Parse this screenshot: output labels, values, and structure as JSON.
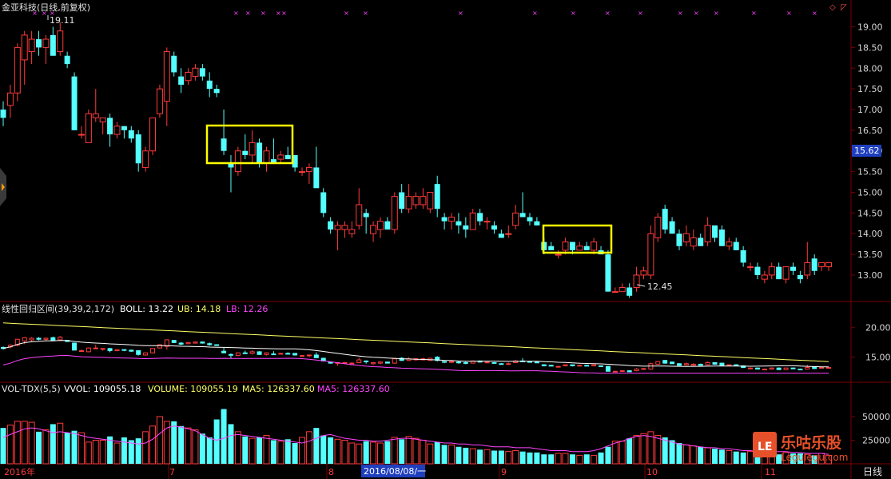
{
  "header": {
    "stock_name": "金亚科技(日线,前复权)",
    "high_label": "19.11",
    "low_label": "12.45",
    "current_price": "15.62"
  },
  "colors": {
    "bg": "#000000",
    "up": "#ff3b3b",
    "down": "#54ffff",
    "grid": "#7a0000",
    "axis_text": "#d6d6d6",
    "highlight_box": "#ffff00",
    "price_tag_bg": "#1f3fbf",
    "boll_mid": "#ffffff",
    "boll_ub": "#ffff66",
    "boll_lb": "#ff44ff",
    "vol_ma": "#ff44ff"
  },
  "boll_panel": {
    "title": "线性回归区间(39,39,2,172)",
    "boll": "BOLL: 13.22",
    "ub": "UB: 14.18",
    "lb": "LB: 12.26"
  },
  "vol_panel": {
    "title": "VOL-TDX(5,5)",
    "vvol": "VVOL: 109055.18",
    "volume": "VOLUME: 109055.19",
    "ma5": "MA5: 126337.60",
    "ma5b": "MA5: 126337.60"
  },
  "x_axis": {
    "labels": [
      "2016年",
      "7",
      "8",
      "9",
      "10",
      "11"
    ],
    "selected_date": "2016/08/08/一",
    "period_button": "日线"
  },
  "watermark": {
    "logo_letter": "LE",
    "brand": "乐咕乐股",
    "url": "Legulegu.com"
  },
  "chart_data": {
    "type": "candlestick",
    "price_axis": {
      "ticks": [
        13.0,
        13.5,
        14.0,
        14.5,
        15.0,
        15.5,
        16.0,
        16.5,
        17.0,
        17.5,
        18.0,
        18.5,
        19.0
      ],
      "range": [
        12.4,
        19.3
      ]
    },
    "boll_axis": {
      "ticks": [
        15.0,
        20.0
      ],
      "tick_labels": [
        "15.00",
        "20.00"
      ]
    },
    "volume_axis": {
      "ticks": [
        25000,
        50000
      ],
      "tick_labels": [
        "25000",
        "50000"
      ],
      "range": [
        0,
        72000
      ]
    },
    "candles": [
      {
        "o": 17.0,
        "h": 17.2,
        "l": 16.6,
        "c": 16.8
      },
      {
        "o": 17.1,
        "h": 17.6,
        "l": 16.8,
        "c": 17.4
      },
      {
        "o": 17.4,
        "h": 18.6,
        "l": 17.2,
        "c": 18.5
      },
      {
        "o": 18.2,
        "h": 18.9,
        "l": 17.6,
        "c": 18.8
      },
      {
        "o": 18.4,
        "h": 18.9,
        "l": 18.1,
        "c": 18.7
      },
      {
        "o": 18.7,
        "h": 18.9,
        "l": 18.3,
        "c": 18.5
      },
      {
        "o": 18.5,
        "h": 18.8,
        "l": 18.1,
        "c": 18.7
      },
      {
        "o": 18.8,
        "h": 19.0,
        "l": 18.3,
        "c": 18.3
      },
      {
        "o": 18.4,
        "h": 19.11,
        "l": 18.3,
        "c": 18.9
      },
      {
        "o": 18.3,
        "h": 18.4,
        "l": 18.0,
        "c": 18.1
      },
      {
        "o": 17.8,
        "h": 17.9,
        "l": 16.5,
        "c": 16.5
      },
      {
        "o": 16.4,
        "h": 16.6,
        "l": 16.3,
        "c": 16.4
      },
      {
        "o": 16.2,
        "h": 17.0,
        "l": 16.2,
        "c": 16.9
      },
      {
        "o": 16.8,
        "h": 17.5,
        "l": 16.7,
        "c": 16.9
      },
      {
        "o": 16.7,
        "h": 16.8,
        "l": 16.4,
        "c": 16.8
      },
      {
        "o": 16.8,
        "h": 16.9,
        "l": 16.1,
        "c": 16.4
      },
      {
        "o": 16.4,
        "h": 16.7,
        "l": 16.3,
        "c": 16.6
      },
      {
        "o": 16.6,
        "h": 16.6,
        "l": 16.3,
        "c": 16.5
      },
      {
        "o": 16.5,
        "h": 16.6,
        "l": 16.2,
        "c": 16.3
      },
      {
        "o": 16.4,
        "h": 16.5,
        "l": 15.5,
        "c": 15.7
      },
      {
        "o": 15.6,
        "h": 16.1,
        "l": 15.5,
        "c": 16.0
      },
      {
        "o": 16.0,
        "h": 16.8,
        "l": 15.9,
        "c": 16.8
      },
      {
        "o": 16.9,
        "h": 17.6,
        "l": 16.8,
        "c": 17.5
      },
      {
        "o": 17.2,
        "h": 18.5,
        "l": 16.6,
        "c": 18.4
      },
      {
        "o": 18.3,
        "h": 18.4,
        "l": 17.8,
        "c": 17.9
      },
      {
        "o": 17.8,
        "h": 18.0,
        "l": 17.4,
        "c": 17.6
      },
      {
        "o": 17.7,
        "h": 18.0,
        "l": 17.6,
        "c": 17.9
      },
      {
        "o": 17.8,
        "h": 18.1,
        "l": 17.7,
        "c": 18.0
      },
      {
        "o": 18.0,
        "h": 18.1,
        "l": 17.7,
        "c": 17.8
      },
      {
        "o": 17.7,
        "h": 17.9,
        "l": 17.3,
        "c": 17.5
      },
      {
        "o": 17.5,
        "h": 17.6,
        "l": 17.3,
        "c": 17.4
      },
      {
        "o": 16.3,
        "h": 17.0,
        "l": 15.9,
        "c": 16.0
      },
      {
        "o": 15.7,
        "h": 15.9,
        "l": 15.0,
        "c": 15.6
      },
      {
        "o": 15.5,
        "h": 16.1,
        "l": 15.4,
        "c": 16.0
      },
      {
        "o": 16.0,
        "h": 16.4,
        "l": 15.8,
        "c": 15.9
      },
      {
        "o": 15.9,
        "h": 16.5,
        "l": 15.7,
        "c": 16.2
      },
      {
        "o": 16.2,
        "h": 16.3,
        "l": 15.6,
        "c": 15.7
      },
      {
        "o": 15.7,
        "h": 16.1,
        "l": 15.5,
        "c": 16.0
      },
      {
        "o": 15.8,
        "h": 16.3,
        "l": 15.7,
        "c": 15.7
      },
      {
        "o": 15.8,
        "h": 16.0,
        "l": 15.7,
        "c": 15.9
      },
      {
        "o": 15.9,
        "h": 16.1,
        "l": 15.8,
        "c": 15.8
      },
      {
        "o": 15.9,
        "h": 15.9,
        "l": 15.5,
        "c": 15.6
      },
      {
        "o": 15.5,
        "h": 15.6,
        "l": 15.4,
        "c": 15.5
      },
      {
        "o": 15.5,
        "h": 15.7,
        "l": 15.2,
        "c": 15.6
      },
      {
        "o": 15.6,
        "h": 16.1,
        "l": 15.3,
        "c": 15.1
      },
      {
        "o": 15.0,
        "h": 15.1,
        "l": 14.4,
        "c": 14.5
      },
      {
        "o": 14.3,
        "h": 14.4,
        "l": 14.0,
        "c": 14.1
      },
      {
        "o": 14.1,
        "h": 14.3,
        "l": 13.6,
        "c": 14.2
      },
      {
        "o": 14.1,
        "h": 14.3,
        "l": 13.9,
        "c": 14.2
      },
      {
        "o": 14.0,
        "h": 14.3,
        "l": 13.9,
        "c": 14.1
      },
      {
        "o": 14.2,
        "h": 15.1,
        "l": 14.1,
        "c": 14.7
      },
      {
        "o": 14.5,
        "h": 14.6,
        "l": 14.0,
        "c": 14.4
      },
      {
        "o": 14.0,
        "h": 14.3,
        "l": 13.8,
        "c": 14.2
      },
      {
        "o": 14.1,
        "h": 14.4,
        "l": 13.9,
        "c": 14.3
      },
      {
        "o": 14.3,
        "h": 14.4,
        "l": 14.1,
        "c": 14.1
      },
      {
        "o": 14.1,
        "h": 15.0,
        "l": 14.0,
        "c": 14.9
      },
      {
        "o": 15.0,
        "h": 15.2,
        "l": 14.5,
        "c": 14.6
      },
      {
        "o": 14.6,
        "h": 15.2,
        "l": 14.5,
        "c": 14.9
      },
      {
        "o": 14.7,
        "h": 15.0,
        "l": 14.6,
        "c": 14.9
      },
      {
        "o": 14.7,
        "h": 15.1,
        "l": 14.6,
        "c": 14.9
      },
      {
        "o": 14.6,
        "h": 15.0,
        "l": 14.5,
        "c": 15.0
      },
      {
        "o": 15.2,
        "h": 15.4,
        "l": 14.4,
        "c": 14.6
      },
      {
        "o": 14.4,
        "h": 14.5,
        "l": 14.1,
        "c": 14.3
      },
      {
        "o": 14.3,
        "h": 14.5,
        "l": 14.1,
        "c": 14.4
      },
      {
        "o": 14.3,
        "h": 14.5,
        "l": 14.0,
        "c": 14.2
      },
      {
        "o": 14.2,
        "h": 14.4,
        "l": 13.9,
        "c": 14.1
      },
      {
        "o": 14.1,
        "h": 14.6,
        "l": 14.1,
        "c": 14.5
      },
      {
        "o": 14.5,
        "h": 14.6,
        "l": 14.2,
        "c": 14.3
      },
      {
        "o": 14.3,
        "h": 14.4,
        "l": 14.1,
        "c": 14.3
      },
      {
        "o": 14.2,
        "h": 14.3,
        "l": 14.0,
        "c": 14.1
      },
      {
        "o": 14.0,
        "h": 14.1,
        "l": 13.9,
        "c": 13.9
      },
      {
        "o": 14.0,
        "h": 14.2,
        "l": 13.9,
        "c": 14.0
      },
      {
        "o": 14.2,
        "h": 14.7,
        "l": 14.1,
        "c": 14.5
      },
      {
        "o": 14.5,
        "h": 15.0,
        "l": 14.4,
        "c": 14.4
      },
      {
        "o": 14.4,
        "h": 14.5,
        "l": 14.2,
        "c": 14.3
      },
      {
        "o": 14.3,
        "h": 14.4,
        "l": 14.2,
        "c": 14.2
      },
      {
        "o": 13.8,
        "h": 13.9,
        "l": 13.5,
        "c": 13.6
      },
      {
        "o": 13.7,
        "h": 13.8,
        "l": 13.6,
        "c": 13.6
      },
      {
        "o": 13.5,
        "h": 13.6,
        "l": 13.4,
        "c": 13.5
      },
      {
        "o": 13.6,
        "h": 13.9,
        "l": 13.5,
        "c": 13.8
      },
      {
        "o": 13.8,
        "h": 13.8,
        "l": 13.5,
        "c": 13.6
      },
      {
        "o": 13.6,
        "h": 13.8,
        "l": 13.6,
        "c": 13.7
      },
      {
        "o": 13.7,
        "h": 13.8,
        "l": 13.6,
        "c": 13.6
      },
      {
        "o": 13.6,
        "h": 13.9,
        "l": 13.5,
        "c": 13.8
      },
      {
        "o": 13.6,
        "h": 13.7,
        "l": 13.5,
        "c": 13.5
      },
      {
        "o": 13.5,
        "h": 13.6,
        "l": 12.6,
        "c": 12.6
      },
      {
        "o": 12.6,
        "h": 12.7,
        "l": 12.6,
        "c": 12.6
      },
      {
        "o": 12.6,
        "h": 12.8,
        "l": 12.6,
        "c": 12.7
      },
      {
        "o": 12.7,
        "h": 12.8,
        "l": 12.45,
        "c": 12.5
      },
      {
        "o": 12.7,
        "h": 13.2,
        "l": 12.6,
        "c": 13.0
      },
      {
        "o": 13.0,
        "h": 13.2,
        "l": 12.9,
        "c": 13.1
      },
      {
        "o": 13.0,
        "h": 14.2,
        "l": 12.9,
        "c": 14.0
      },
      {
        "o": 13.9,
        "h": 14.5,
        "l": 13.8,
        "c": 14.4
      },
      {
        "o": 14.6,
        "h": 14.7,
        "l": 14.0,
        "c": 14.1
      },
      {
        "o": 14.3,
        "h": 14.4,
        "l": 14.0,
        "c": 14.0
      },
      {
        "o": 14.0,
        "h": 14.1,
        "l": 13.6,
        "c": 13.7
      },
      {
        "o": 13.8,
        "h": 14.2,
        "l": 13.7,
        "c": 14.0
      },
      {
        "o": 13.7,
        "h": 14.1,
        "l": 13.6,
        "c": 13.9
      },
      {
        "o": 13.9,
        "h": 14.0,
        "l": 13.7,
        "c": 13.7
      },
      {
        "o": 13.8,
        "h": 14.4,
        "l": 13.7,
        "c": 14.2
      },
      {
        "o": 14.2,
        "h": 14.2,
        "l": 13.8,
        "c": 13.9
      },
      {
        "o": 14.1,
        "h": 14.2,
        "l": 13.7,
        "c": 13.7
      },
      {
        "o": 13.7,
        "h": 13.9,
        "l": 13.6,
        "c": 13.8
      },
      {
        "o": 13.8,
        "h": 13.9,
        "l": 13.6,
        "c": 13.6
      },
      {
        "o": 13.6,
        "h": 13.7,
        "l": 13.2,
        "c": 13.3
      },
      {
        "o": 13.2,
        "h": 13.3,
        "l": 13.1,
        "c": 13.2
      },
      {
        "o": 13.2,
        "h": 13.3,
        "l": 12.9,
        "c": 13.0
      },
      {
        "o": 12.9,
        "h": 13.1,
        "l": 12.8,
        "c": 13.0
      },
      {
        "o": 13.0,
        "h": 13.3,
        "l": 12.9,
        "c": 13.2
      },
      {
        "o": 13.2,
        "h": 13.3,
        "l": 12.9,
        "c": 12.9
      },
      {
        "o": 12.9,
        "h": 13.2,
        "l": 12.8,
        "c": 13.2
      },
      {
        "o": 13.2,
        "h": 13.3,
        "l": 13.0,
        "c": 13.1
      },
      {
        "o": 13.0,
        "h": 13.1,
        "l": 12.8,
        "c": 12.9
      },
      {
        "o": 13.0,
        "h": 13.8,
        "l": 12.9,
        "c": 13.3
      },
      {
        "o": 13.4,
        "h": 13.5,
        "l": 13.0,
        "c": 13.1
      },
      {
        "o": 13.2,
        "h": 13.3,
        "l": 13.1,
        "c": 13.3
      },
      {
        "o": 13.2,
        "h": 13.3,
        "l": 13.1,
        "c": 13.3
      }
    ],
    "volume_ma5": [
      28000,
      31000,
      34000,
      37000,
      38000,
      37000,
      35000,
      33000,
      34000,
      33000,
      32000,
      30000,
      28000,
      27000,
      26000,
      25000,
      24000,
      23000,
      22000,
      21000,
      22000,
      26000,
      32000,
      38000,
      40000,
      39000,
      37000,
      35000,
      31000,
      27000,
      25000,
      27000,
      30000,
      31000,
      30000,
      29000,
      28000,
      27000,
      26000,
      25000,
      24000,
      23000,
      22000,
      24000,
      27000,
      30000,
      31000,
      29000,
      27000,
      26000,
      25000,
      25000,
      24000,
      24000,
      25000,
      26000,
      27000,
      27000,
      26000,
      25000,
      24000,
      23000,
      22000,
      22000,
      21000,
      21000,
      20000,
      20000,
      19000,
      18000,
      18000,
      18000,
      17000,
      17000,
      17000,
      16000,
      15000,
      14000,
      14000,
      14000,
      13000,
      13000,
      13000,
      14000,
      16000,
      19000,
      22000,
      24000,
      27000,
      29000,
      30000,
      29000,
      27000,
      25000,
      23000,
      21000,
      20000,
      19000,
      18000,
      17000,
      17000,
      16000,
      16000,
      15000,
      14000,
      14000,
      13000,
      13000,
      13000,
      13000,
      13000,
      12000,
      12000,
      11000,
      11000,
      11000,
      10000,
      10000
    ],
    "volumes": [
      38000,
      41000,
      45000,
      45000,
      44000,
      34000,
      36000,
      42000,
      43000,
      33000,
      35000,
      33000,
      23000,
      25000,
      25000,
      29000,
      22000,
      28000,
      25000,
      27000,
      34000,
      40000,
      50000,
      45000,
      45000,
      40000,
      38000,
      36000,
      32000,
      28000,
      47000,
      58000,
      42000,
      34000,
      29000,
      27000,
      28000,
      30000,
      25000,
      24000,
      26000,
      22000,
      28000,
      34000,
      38000,
      30000,
      28000,
      26000,
      25000,
      22000,
      21000,
      24000,
      23000,
      22000,
      24000,
      28000,
      26000,
      29000,
      27000,
      25000,
      21000,
      23000,
      20000,
      20000,
      18000,
      17000,
      16000,
      15000,
      15000,
      14000,
      14000,
      13000,
      14000,
      13000,
      12000,
      12000,
      10000,
      10000,
      11000,
      11000,
      10000,
      9000,
      10000,
      9000,
      12000,
      18000,
      24000,
      24000,
      27000,
      30000,
      32000,
      34000,
      30000,
      28000,
      25000,
      22000,
      20000,
      19000,
      18000,
      17000,
      16000,
      15000,
      14000,
      13000,
      12000,
      13000,
      12000,
      12000,
      11000,
      10000,
      12000,
      11000,
      11000,
      10000,
      9000,
      11000,
      9000,
      9000
    ]
  }
}
